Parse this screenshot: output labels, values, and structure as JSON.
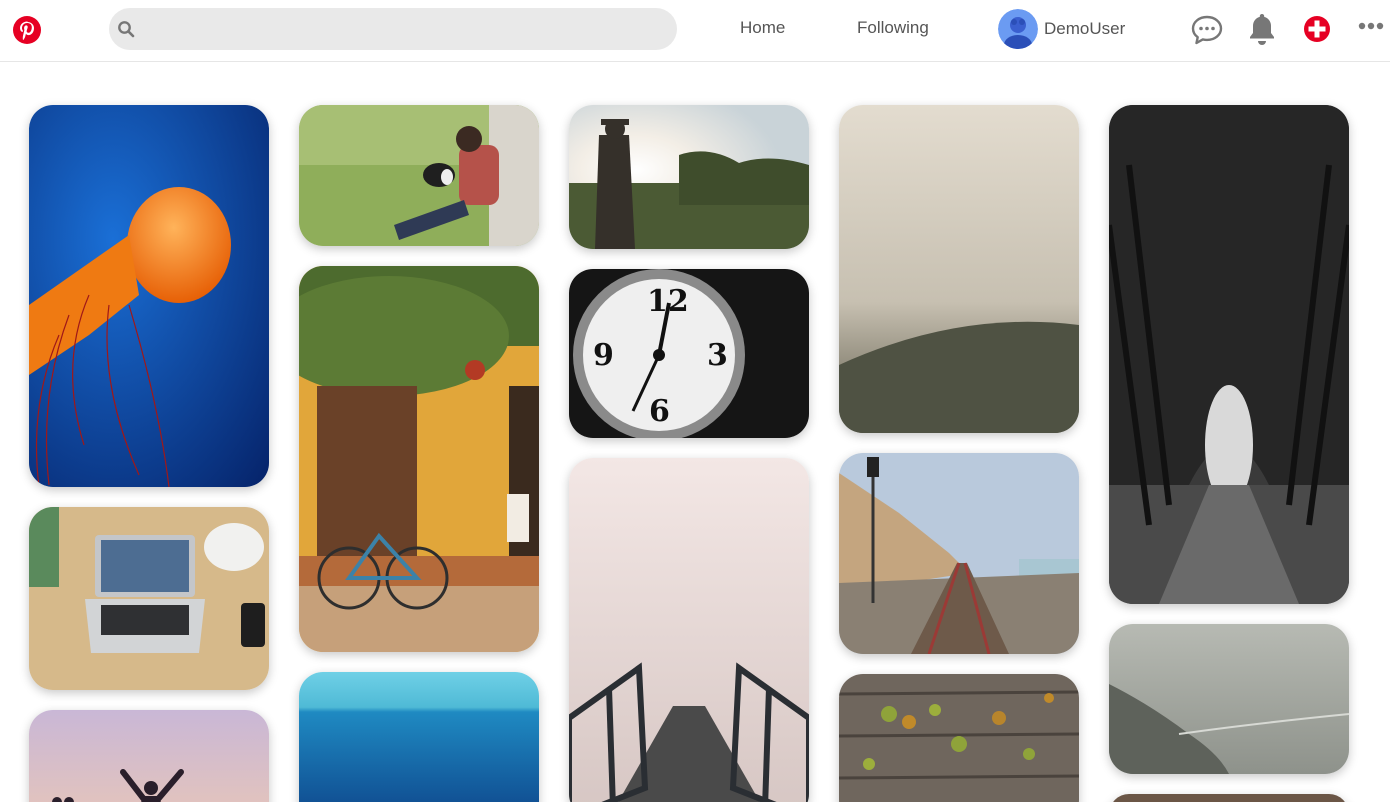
{
  "header": {
    "logo_icon": "pinterest-logo-icon",
    "search": {
      "icon": "search-icon",
      "placeholder": "",
      "value": ""
    },
    "nav": {
      "home_label": "Home",
      "following_label": "Following"
    },
    "user": {
      "name": "DemoUser",
      "avatar_icon": "user-avatar"
    },
    "icons": [
      "messages-icon",
      "notifications-bell-icon",
      "add-pin-icon",
      "more-options-icon"
    ],
    "brand_color": "#e60023"
  },
  "pins": [
    {
      "id": "jellyfish",
      "subject": "orange jellyfish"
    },
    {
      "id": "laptop-desk",
      "subject": "laptop on desk"
    },
    {
      "id": "silhouette-jump",
      "subject": "person jumping silhouette"
    },
    {
      "id": "man-dog-grass",
      "subject": "man with dog in grass"
    },
    {
      "id": "yellow-house-bike",
      "subject": "yellow house with bicycle"
    },
    {
      "id": "blue-ocean",
      "subject": "blue ocean horizon"
    },
    {
      "id": "sunlit-man",
      "subject": "man in sunlight"
    },
    {
      "id": "clock",
      "subject": "black and white clock"
    },
    {
      "id": "foggy-pier",
      "subject": "pier into fog"
    },
    {
      "id": "misty-hill",
      "subject": "misty hill"
    },
    {
      "id": "railway-coast",
      "subject": "railway along coast"
    },
    {
      "id": "wood-leaves",
      "subject": "leaves on wooden planks"
    },
    {
      "id": "tree-tunnel",
      "subject": "tree tunnel road"
    },
    {
      "id": "foggy-coast",
      "subject": "foggy coastline"
    },
    {
      "id": "bottom-partial",
      "subject": "partial pin"
    }
  ]
}
